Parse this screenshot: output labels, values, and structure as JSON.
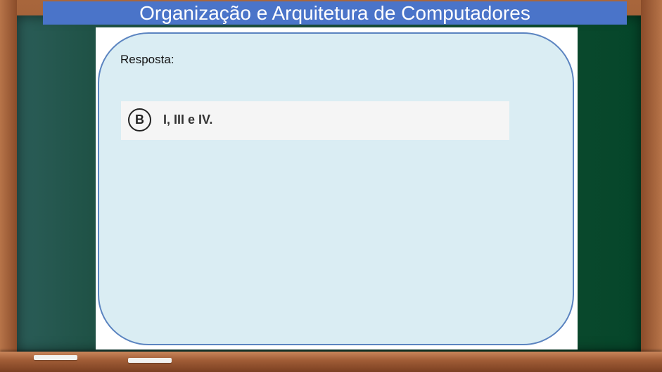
{
  "title": "Organização e Arquitetura de Computadores",
  "response_label": "Resposta:",
  "answer": {
    "letter": "B",
    "text": "I, III e IV."
  },
  "colors": {
    "title_bar": "#4a74c9",
    "bubble_fill": "#daedf3",
    "bubble_border": "#5b84c0",
    "board": "#1b4d3c"
  }
}
